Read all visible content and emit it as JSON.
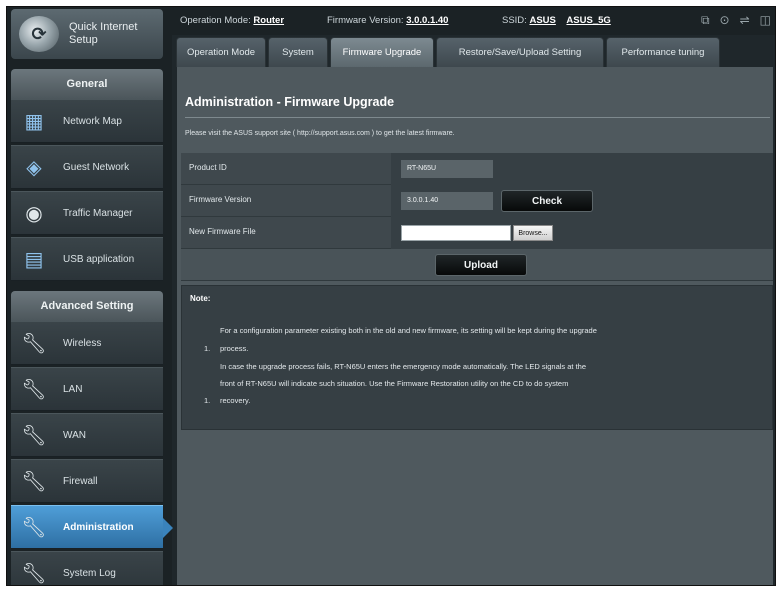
{
  "topbar": {
    "operation_mode_label": "Operation Mode:",
    "operation_mode_value": "Router",
    "firmware_label": "Firmware Version:",
    "firmware_value": "3.0.0.1.40",
    "ssid_label": "SSID:",
    "ssid_1": "ASUS",
    "ssid_2": "ASUS_5G"
  },
  "sidebar": {
    "quick_setup": {
      "line1": "Quick Internet",
      "line2": "Setup"
    },
    "general_header": "General",
    "general_items": [
      {
        "label": "Network Map",
        "icon": "network-map-icon"
      },
      {
        "label": "Guest Network",
        "icon": "guest-network-icon"
      },
      {
        "label": "Traffic Manager",
        "icon": "traffic-manager-icon"
      },
      {
        "label": "USB application",
        "icon": "usb-application-icon"
      }
    ],
    "advanced_header": "Advanced Setting",
    "advanced_items": [
      {
        "label": "Wireless",
        "icon": "wrench-icon"
      },
      {
        "label": "LAN",
        "icon": "wrench-icon"
      },
      {
        "label": "WAN",
        "icon": "wrench-icon"
      },
      {
        "label": "Firewall",
        "icon": "wrench-icon"
      },
      {
        "label": "Administration",
        "icon": "wrench-icon",
        "active": true
      },
      {
        "label": "System Log",
        "icon": "wrench-icon"
      }
    ]
  },
  "tabs": [
    {
      "label": "Operation Mode"
    },
    {
      "label": "System"
    },
    {
      "label": "Firmware Upgrade",
      "active": true
    },
    {
      "label": "Restore/Save/Upload Setting"
    },
    {
      "label": "Performance tuning"
    }
  ],
  "page": {
    "title": "Administration - Firmware Upgrade",
    "intro": "Please visit the ASUS support site ( http://support.asus.com ) to get the latest firmware."
  },
  "form": {
    "product_id_label": "Product ID",
    "product_id_value": "RT-N65U",
    "firmware_version_label": "Firmware Version",
    "firmware_version_value": "3.0.0.1.40",
    "check_label": "Check",
    "new_firmware_label": "New Firmware File",
    "browse_label": "Browse...",
    "upload_label": "Upload"
  },
  "note": {
    "title": "Note:",
    "item1_num": "1.",
    "item1_a": "For a configuration parameter existing both in the old and new firmware, its setting will be kept during the upgrade",
    "item1_b": "process.",
    "item2_num": "1.",
    "item2_a": "In case the upgrade process fails, RT-N65U enters the emergency mode automatically. The LED signals at the",
    "item2_b": "front of RT-N65U will indicate such situation. Use the Firmware Restoration utility on the CD to do system",
    "item2_c": "recovery."
  }
}
